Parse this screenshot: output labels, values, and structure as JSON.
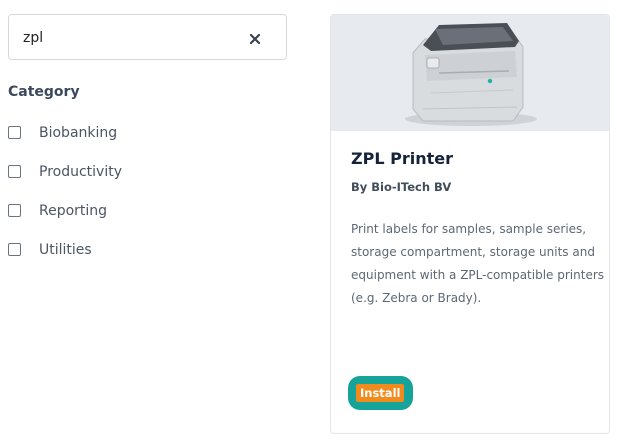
{
  "search": {
    "value": "zpl",
    "clear_icon": "close-icon"
  },
  "category": {
    "title": "Category",
    "items": [
      {
        "label": "Biobanking",
        "checked": false
      },
      {
        "label": "Productivity",
        "checked": false
      },
      {
        "label": "Reporting",
        "checked": false
      },
      {
        "label": "Utilities",
        "checked": false
      }
    ]
  },
  "app_card": {
    "image_icon": "label-printer-image",
    "title": "ZPL Printer",
    "vendor": "By Bio-ITech BV",
    "description": "Print labels for samples, sample series, storage compartment, storage units and equipment with a ZPL-compatible printers (e.g. Zebra or Brady).",
    "install_label": "Install"
  },
  "colors": {
    "install_outer": "#16a39a",
    "install_inner": "#f28b1e",
    "image_bg": "#e7eaee"
  }
}
